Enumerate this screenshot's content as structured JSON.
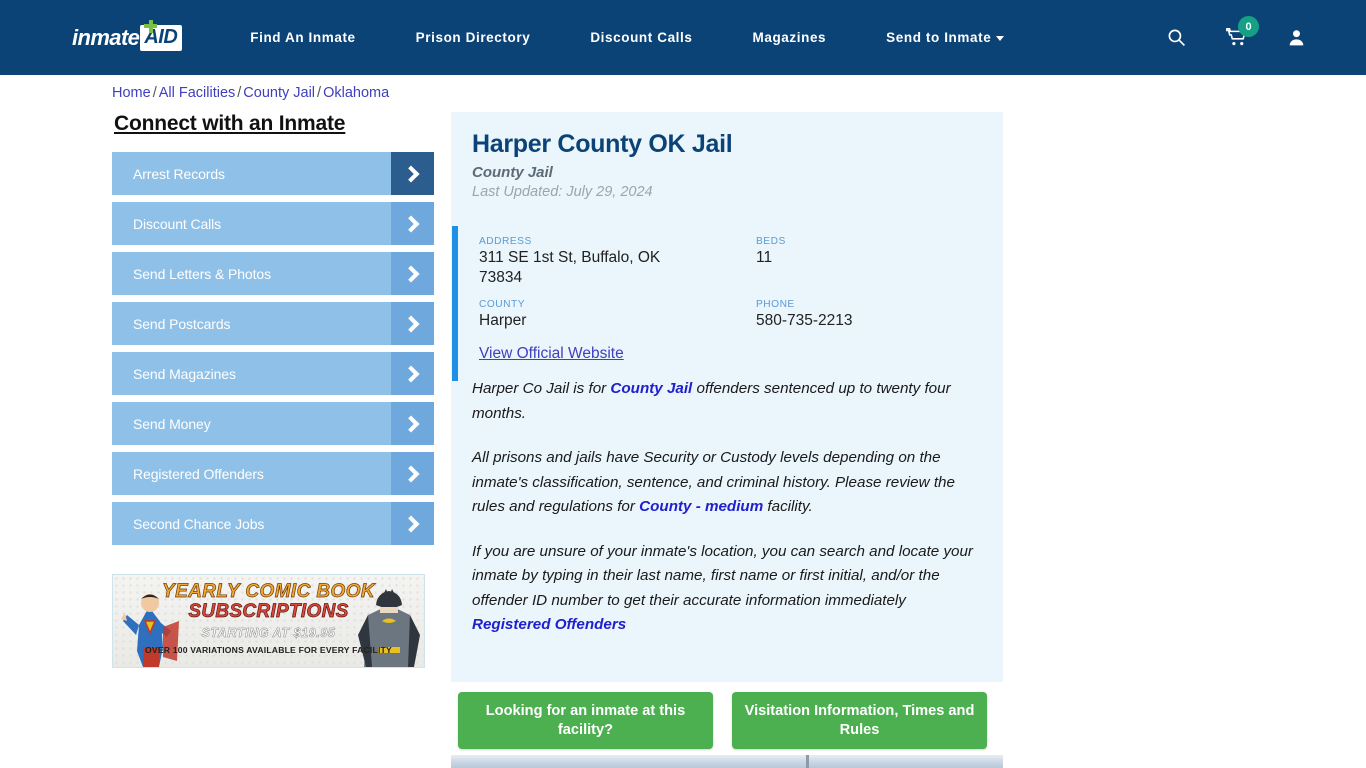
{
  "header": {
    "logo": {
      "word": "inmate",
      "badge": "AID",
      "cross_icon": "green-plus-icon"
    },
    "nav": [
      {
        "label": "Find An Inmate",
        "has_caret": false
      },
      {
        "label": "Prison Directory",
        "has_caret": false
      },
      {
        "label": "Discount Calls",
        "has_caret": false
      },
      {
        "label": "Magazines",
        "has_caret": false
      },
      {
        "label": "Send to Inmate",
        "has_caret": true
      }
    ],
    "icons": {
      "search": "search-icon",
      "cart": "cart-icon",
      "cart_count": "0",
      "account": "user-icon"
    },
    "bg_color": "#0c4377"
  },
  "breadcrumb": {
    "items": [
      "Home",
      "All Facilities",
      "County Jail",
      "Oklahoma"
    ],
    "separator": "/"
  },
  "sidebar": {
    "title": "Connect with an Inmate",
    "items": [
      {
        "label": "Arrest Records",
        "active": true
      },
      {
        "label": "Discount Calls",
        "active": false
      },
      {
        "label": "Send Letters & Photos",
        "active": false
      },
      {
        "label": "Send Postcards",
        "active": false
      },
      {
        "label": "Send Magazines",
        "active": false
      },
      {
        "label": "Send Money",
        "active": false
      },
      {
        "label": "Registered Offenders",
        "active": false
      },
      {
        "label": "Second Chance Jobs",
        "active": false
      }
    ],
    "ad": {
      "line1": "YEARLY COMIC BOOK",
      "line2": "SUBSCRIPTIONS",
      "line3": "STARTING AT $19.95",
      "line4": "OVER 100 VARIATIONS AVAILABLE FOR EVERY FACILITY"
    }
  },
  "facility": {
    "name": "Harper County OK Jail",
    "type": "County Jail",
    "last_updated": "Last Updated: July 29, 2024",
    "fields": {
      "address_label": "ADDRESS",
      "address_value": "311 SE 1st St, Buffalo, OK 73834",
      "beds_label": "BEDS",
      "beds_value": "11",
      "county_label": "COUNTY",
      "county_value": "Harper",
      "phone_label": "PHONE",
      "phone_value": "580-735-2213"
    },
    "official_website_link": "View Official Website",
    "accent_color": "#1e90e8"
  },
  "description": {
    "p1_a": "Harper Co Jail is for ",
    "p1_link": "County Jail",
    "p1_b": " offenders sentenced up to twenty four months.",
    "p2_a": "All prisons and jails have Security or Custody levels depending on the inmate's classification, sentence, and criminal history. Please review the rules and regulations for ",
    "p2_link": "County - medium",
    "p2_b": " facility.",
    "p3_a": "If you are unsure of your inmate's location, you can search and locate your inmate by typing in their last name, first name or first initial, and/or the offender ID number to get their accurate information immediately ",
    "p3_link": "Registered Offenders"
  },
  "cta": {
    "button1": "Looking for an inmate at this facility?",
    "button2": "Visitation Information, Times and Rules",
    "color": "#4caf50"
  }
}
